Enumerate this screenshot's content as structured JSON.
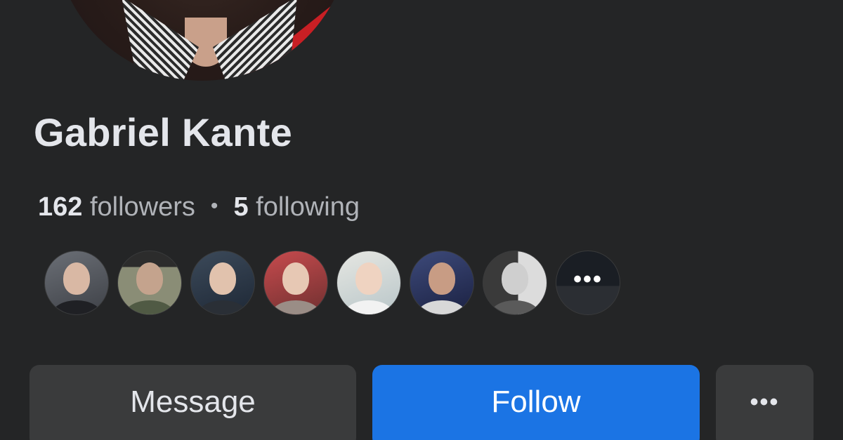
{
  "profile": {
    "name": "Gabriel Kante",
    "followers_count": "162",
    "followers_label": "followers",
    "separator": "•",
    "following_count": "5",
    "following_label": "following"
  },
  "follower_avatars": [
    {
      "icon": "avatar-woman-1"
    },
    {
      "icon": "avatar-man-1"
    },
    {
      "icon": "avatar-woman-2"
    },
    {
      "icon": "avatar-woman-3"
    },
    {
      "icon": "avatar-woman-4"
    },
    {
      "icon": "avatar-couple"
    },
    {
      "icon": "avatar-woman-5"
    }
  ],
  "more_avatars_label": "•••",
  "actions": {
    "message_label": "Message",
    "follow_label": "Follow",
    "more_label": "•••"
  },
  "colors": {
    "background": "#242526",
    "primary_text": "#e4e6eb",
    "secondary_text": "#b0b3b8",
    "button_gray": "#3a3b3c",
    "follow_blue": "#1b74e4"
  }
}
